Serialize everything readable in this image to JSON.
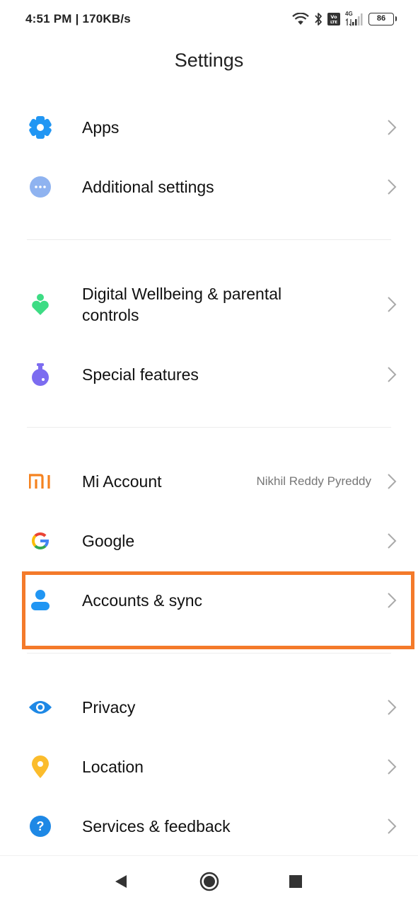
{
  "status_bar": {
    "time": "4:51 PM | 170KB/s",
    "network": "4G",
    "volte": "Vo LTE",
    "battery": "86"
  },
  "header": {
    "title": "Settings"
  },
  "items": [
    {
      "label": "Apps",
      "icon": "gear-icon",
      "color": "#2196f3"
    },
    {
      "label": "Additional settings",
      "icon": "more-dots-icon",
      "color": "#8fb3f0"
    },
    {
      "label": "Digital Wellbeing & parental controls",
      "icon": "wellbeing-heart-icon",
      "color": "#3ddc84"
    },
    {
      "label": "Special features",
      "icon": "flask-icon",
      "color": "#7c6cf0"
    },
    {
      "label": "Mi Account",
      "value": "Nikhil Reddy Pyreddy",
      "icon": "mi-logo-icon",
      "color": "#f5821f"
    },
    {
      "label": "Google",
      "icon": "google-logo-icon"
    },
    {
      "label": "Accounts & sync",
      "icon": "person-icon",
      "color": "#2196f3",
      "highlighted": true
    },
    {
      "label": "Privacy",
      "icon": "eye-icon",
      "color": "#1e88e5"
    },
    {
      "label": "Location",
      "icon": "location-pin-icon",
      "color": "#fbbc2c"
    },
    {
      "label": "Services & feedback",
      "icon": "help-icon",
      "color": "#1e88e5"
    }
  ],
  "highlight_color": "#f47a2a"
}
